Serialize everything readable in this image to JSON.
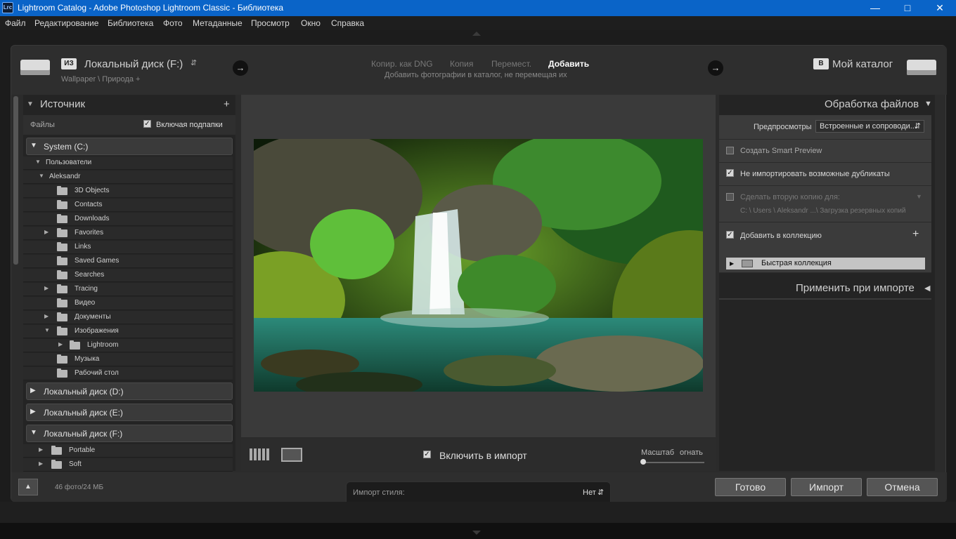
{
  "window": {
    "title": "Lightroom Catalog - Adobe Photoshop Lightroom Classic - Библиотека",
    "logo": "Lrc"
  },
  "menu": [
    "Файл",
    "Редактирование",
    "Библиотека",
    "Фото",
    "Метаданные",
    "Просмотр",
    "Окно",
    "Справка"
  ],
  "source": {
    "from_tag": "ИЗ",
    "drive": "Локальный диск (F:)",
    "path": "Wallpaper \\ Природа +"
  },
  "modes": {
    "dng": "Копир. как DNG",
    "copy": "Копия",
    "move": "Перемест.",
    "add": "Добавить",
    "description": "Добавить фотографии в каталог, не перемещая их"
  },
  "dest": {
    "to_tag": "В",
    "label": "Мой каталог"
  },
  "left_panel": {
    "title": "Источник",
    "files_label": "Файлы",
    "include_subfolders": "Включая подпапки",
    "volume_c": "System  (C:)",
    "users": "Пользователи",
    "user": "Aleksandr",
    "folders": [
      "3D Objects",
      "Contacts",
      "Downloads",
      "Favorites",
      "Links",
      "Saved Games",
      "Searches",
      "Tracing",
      "Видео",
      "Документы",
      "Изображения",
      "Lightroom",
      "Музыка",
      "Рабочий стол"
    ],
    "volume_d": "Локальный диск (D:)",
    "volume_e": "Локальный диск (E:)",
    "volume_f": "Локальный диск (F:)",
    "f_folders": [
      "Portable",
      "Soft"
    ]
  },
  "center": {
    "include_label": "Включить в импорт",
    "zoom_label": "Масштаб",
    "fit_label": "огнать"
  },
  "right_panel": {
    "title": "Обработка файлов",
    "previews_label": "Предпросмотры",
    "previews_value": "Встроенные и сопроводи...",
    "smart_preview": "Создать Smart Preview",
    "no_duplicates": "Не импортировать возможные дубликаты",
    "second_copy": "Сделать вторую копию для:",
    "second_copy_path": "C: \\ Users \\ Aleksandr ...\\ Загрузка резервных копий",
    "add_collection": "Добавить в коллекцию",
    "quick_collection": "Быстрая коллекция",
    "apply_title": "Применить при импорте"
  },
  "bottom": {
    "count": "46 фото/24 МБ",
    "preset_label": "Импорт стиля:",
    "preset_value": "Нет",
    "done": "Готово",
    "import": "Импорт",
    "cancel": "Отмена"
  }
}
